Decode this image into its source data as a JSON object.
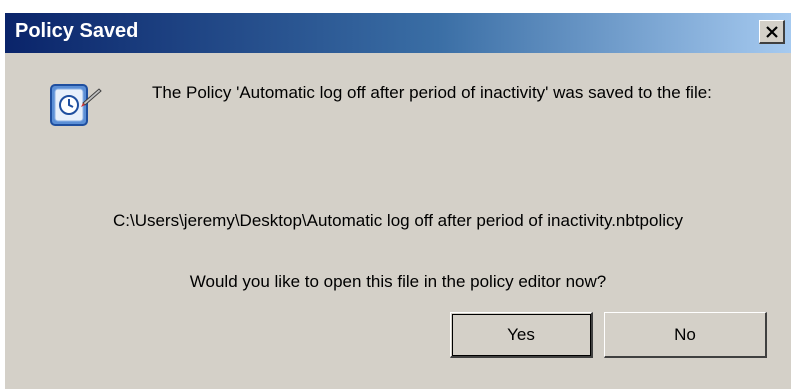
{
  "window": {
    "title": "Policy Saved",
    "close_label": "×"
  },
  "message": {
    "text": "The Policy 'Automatic log off after period of inactivity' was saved to the file:",
    "file_path": "C:\\Users\\jeremy\\Desktop\\Automatic log off after period of inactivity.nbtpolicy",
    "question": "Would you like to open this file in the policy editor now?"
  },
  "buttons": {
    "yes_label": "Yes",
    "no_label": "No"
  },
  "icons": {
    "info": "policy-info-icon",
    "close": "close-icon"
  },
  "colors": {
    "dialog_bg": "#d4d0c8",
    "title_start": "#0a246a",
    "title_end": "#a6caf0",
    "icon_blue": "#1f5fbf"
  }
}
